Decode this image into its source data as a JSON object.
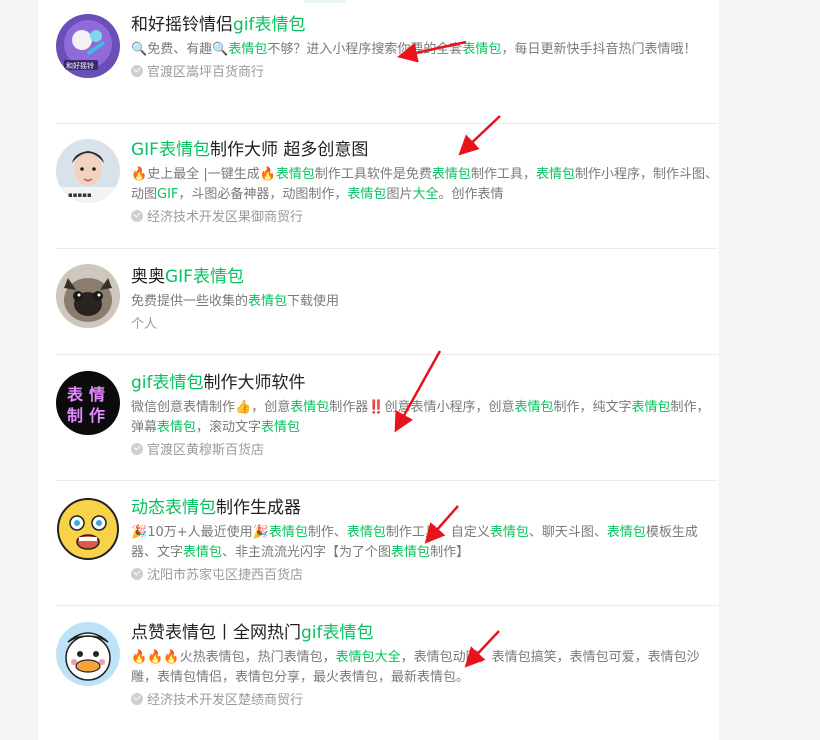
{
  "results": [
    {
      "title": [
        {
          "t": "和好摇铃情侣"
        },
        {
          "t": "gif表情包",
          "hl": true
        }
      ],
      "desc": [
        {
          "t": "🔍",
          "e": true
        },
        {
          "t": "免费、有趣"
        },
        {
          "t": "🔍",
          "e": true
        },
        {
          "t": "表情包",
          "hl": true
        },
        {
          "t": "不够？进入小程序搜索你要的全套"
        },
        {
          "t": "表情包",
          "hl": true
        },
        {
          "t": "，每日更新快手抖音热门表情哦！"
        }
      ],
      "meta": "官渡区嵩坪百货商行",
      "avatar_label": "和好摇铃"
    },
    {
      "title": [
        {
          "t": "GIF表情包",
          "hl": true
        },
        {
          "t": "制作大师 超多创意图"
        }
      ],
      "desc": [
        {
          "t": "🔥",
          "e": true
        },
        {
          "t": "史上最全 |一键生成"
        },
        {
          "t": "🔥",
          "e": true
        },
        {
          "t": "表情包",
          "hl": true
        },
        {
          "t": "制作工具软件是免费"
        },
        {
          "t": "表情包",
          "hl": true
        },
        {
          "t": "制作工具，"
        },
        {
          "t": "表情包",
          "hl": true
        },
        {
          "t": "制作小程序，制作斗图、动图"
        },
        {
          "t": "GIF",
          "hl": true
        },
        {
          "t": "，斗图必备神器，动图制作，"
        },
        {
          "t": "表情包",
          "hl": true
        },
        {
          "t": "图片"
        },
        {
          "t": "大全",
          "hl": true
        },
        {
          "t": "。创作表情"
        }
      ],
      "meta": "经济技术开发区果御商贸行"
    },
    {
      "title": [
        {
          "t": "奥奥"
        },
        {
          "t": "GIF表情包",
          "hl": true
        }
      ],
      "desc": [
        {
          "t": "免费提供一些收集的"
        },
        {
          "t": "表情包",
          "hl": true
        },
        {
          "t": "下载使用"
        }
      ],
      "meta": "个人"
    },
    {
      "title": [
        {
          "t": "gif表情包",
          "hl": true
        },
        {
          "t": "制作大师软件"
        }
      ],
      "desc": [
        {
          "t": "微信创意表情制作"
        },
        {
          "t": "👍",
          "e": true
        },
        {
          "t": "，创意"
        },
        {
          "t": "表情包",
          "hl": true
        },
        {
          "t": "制作器"
        },
        {
          "t": "‼️",
          "e": true
        },
        {
          "t": "创意表情小程序，创意"
        },
        {
          "t": "表情包",
          "hl": true
        },
        {
          "t": "制作，纯文字"
        },
        {
          "t": "表情包",
          "hl": true
        },
        {
          "t": "制作，弹幕"
        },
        {
          "t": "表情包",
          "hl": true
        },
        {
          "t": "，滚动文字"
        },
        {
          "t": "表情包",
          "hl": true
        }
      ],
      "meta": "官渡区黄穆斯百货店",
      "avatar_text": [
        "表",
        "情",
        "制",
        "作"
      ]
    },
    {
      "title": [
        {
          "t": "动态表情包",
          "hl": true
        },
        {
          "t": "制作生成器"
        }
      ],
      "desc": [
        {
          "t": "🎉",
          "e": true
        },
        {
          "t": "10万+人最近使用"
        },
        {
          "t": "🎉",
          "e": true
        },
        {
          "t": "表情包",
          "hl": true
        },
        {
          "t": "制作、"
        },
        {
          "t": "表情包",
          "hl": true
        },
        {
          "t": "制作工具、自定义"
        },
        {
          "t": "表情包",
          "hl": true
        },
        {
          "t": "、聊天斗图、"
        },
        {
          "t": "表情包",
          "hl": true
        },
        {
          "t": "模板生成器、文字"
        },
        {
          "t": "表情包",
          "hl": true
        },
        {
          "t": "、非主流流光闪字【为了个图"
        },
        {
          "t": "表情包",
          "hl": true
        },
        {
          "t": "制作】"
        }
      ],
      "meta": "沈阳市苏家屯区捷西百货店"
    },
    {
      "title": [
        {
          "t": "点赞表情包丨全网热门"
        },
        {
          "t": "gif表情包",
          "hl": true
        }
      ],
      "desc": [
        {
          "t": "🔥🔥🔥",
          "e": true
        },
        {
          "t": "火热表情包，热门表情包，"
        },
        {
          "t": "表情包大全",
          "hl": true
        },
        {
          "t": "，表情包动图，表情包搞笑，表情包可爱，表情包沙雕，表情包情侣，表情包分享，最火表情包，最新表情包。"
        }
      ],
      "meta": "经济技术开发区楚绩商贸行"
    }
  ],
  "colors": {
    "highlight": "#07c160",
    "arrow": "#e8141c"
  }
}
